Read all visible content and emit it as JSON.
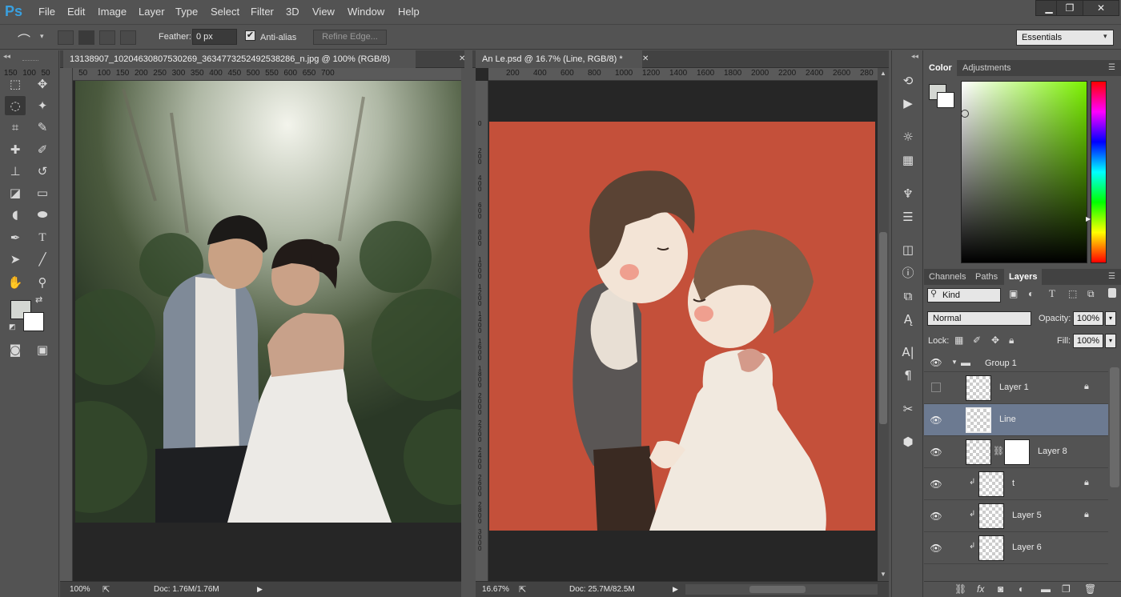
{
  "app": {
    "logo": "Ps",
    "menu": [
      "File",
      "Edit",
      "Image",
      "Layer",
      "Type",
      "Select",
      "Filter",
      "3D",
      "View",
      "Window",
      "Help"
    ],
    "window_controls": {
      "minimize": "▁",
      "restore": "❐",
      "close": "✕"
    }
  },
  "options_bar": {
    "feather_label": "Feather:",
    "feather_value": "0 px",
    "antialias_label": "Anti-alias",
    "antialias_checked": "✔",
    "refine_edge_label": "Refine Edge...",
    "workspace": "Essentials"
  },
  "doc1": {
    "tab_title": "13138907_10204630807530269_3634773252492538286_n.jpg @ 100% (RGB/8)",
    "tab_close": "✕",
    "ruler_h": [
      "300",
      "250",
      "200",
      "150",
      "100",
      "50",
      "0",
      "50",
      "100",
      "150",
      "200",
      "250",
      "300",
      "350",
      "400",
      "450",
      "500",
      "550",
      "600",
      "650",
      "700"
    ],
    "zoom": "100%",
    "doc_size": "Doc: 1.76M/1.76M"
  },
  "doc2": {
    "tab_title": "An Le.psd @ 16.7% (Line, RGB/8) *",
    "tab_close": "✕",
    "ruler_h": [
      "200",
      "400",
      "600",
      "800",
      "1000",
      "1200",
      "1400",
      "1600",
      "1800",
      "2000",
      "2200",
      "2400",
      "2600",
      "280"
    ],
    "ruler_v": [
      "0",
      "2 0 0",
      "4 0 0",
      "6 0 0",
      "8 0 0",
      "1 0 0 0",
      "1 2 0 0",
      "1 4 0 0",
      "1 6 0 0",
      "1 8 0 0",
      "2 0 0 0",
      "2 2 0 0",
      "2 4 0 0",
      "2 6 0 0",
      "2 8 0 0",
      "3 0 0 0"
    ],
    "zoom": "16.67%",
    "doc_size": "Doc: 25.7M/82.5M"
  },
  "colors": {
    "canvas_bg": "#c4503a",
    "foreground": "#d4d7d2",
    "background": "#ffffff",
    "selected_layer": "#6c7a91"
  },
  "color_panel": {
    "tabs": [
      "Color",
      "Adjustments"
    ]
  },
  "layers_panel": {
    "tabs": [
      "Channels",
      "Paths",
      "Layers"
    ],
    "kind_filter": "Kind",
    "blend_mode": "Normal",
    "opacity_label": "Opacity:",
    "opacity_value": "100%",
    "lock_label": "Lock:",
    "fill_label": "Fill:",
    "fill_value": "100%",
    "group_name": "Group 1",
    "layers": [
      {
        "name": "Layer 1",
        "visible": false,
        "locked": true,
        "selected": false
      },
      {
        "name": "Line",
        "visible": true,
        "locked": false,
        "selected": true
      },
      {
        "name": "Layer 8",
        "visible": true,
        "locked": false,
        "selected": false
      },
      {
        "name": "t",
        "visible": true,
        "locked": true,
        "selected": false
      },
      {
        "name": "Layer 5",
        "visible": true,
        "locked": true,
        "selected": false
      },
      {
        "name": "Layer 6",
        "visible": true,
        "locked": false,
        "selected": false
      }
    ]
  }
}
